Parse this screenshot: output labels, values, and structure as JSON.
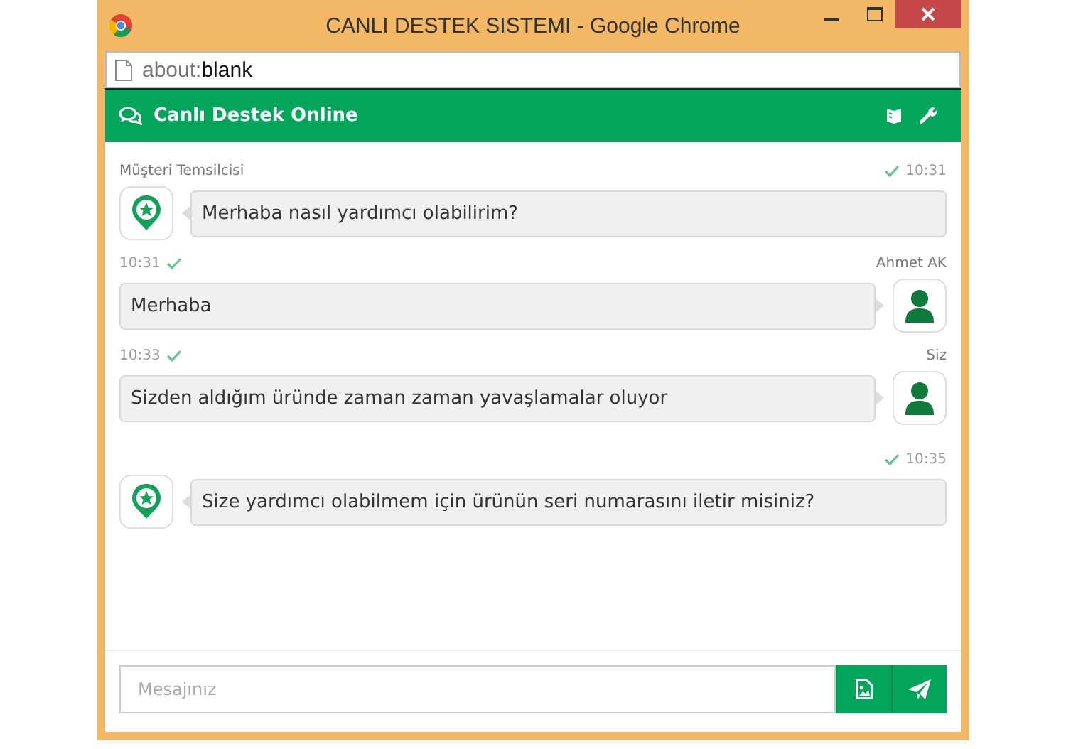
{
  "window": {
    "title": "CANLI DESTEK SISTEMI - Google Chrome"
  },
  "address_bar": {
    "prefix": "about:",
    "value": "blank"
  },
  "chat_header": {
    "title": "Canlı Destek Online"
  },
  "messages": [
    {
      "kind": "agent",
      "name": "Müşteri Temsilcisi",
      "time": "10:31",
      "read": true,
      "text": "Merhaba nasıl yardımcı olabilirim?"
    },
    {
      "kind": "user",
      "name": "Ahmet AK",
      "time": "10:31",
      "read": true,
      "text": "Merhaba"
    },
    {
      "kind": "user",
      "name": "Siz",
      "time": "10:33",
      "read": true,
      "text": "Sizden aldığım üründe zaman zaman yavaşlamalar oluyor"
    },
    {
      "kind": "agent",
      "time": "10:35",
      "read": true,
      "text": "Size yardımcı olabilmem için ürünün seri numarasını iletir misiniz?"
    }
  ],
  "composer": {
    "placeholder": "Mesajınız"
  }
}
